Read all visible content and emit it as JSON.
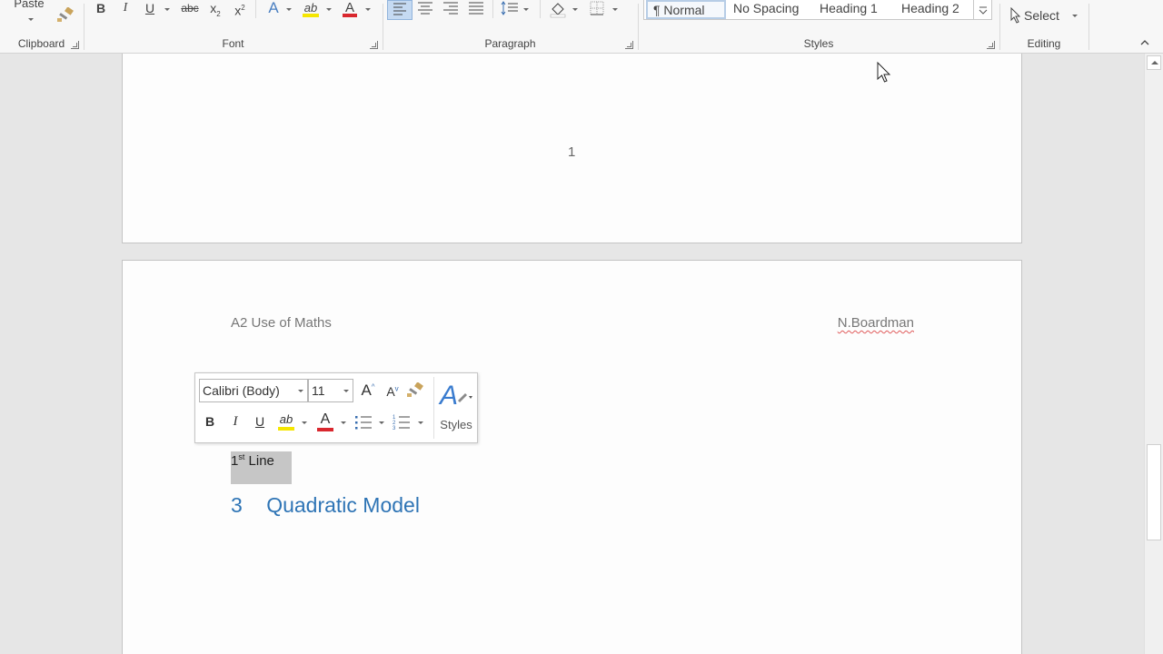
{
  "ribbon": {
    "clipboard": {
      "paste_label": "Paste",
      "group_label": "Clipboard"
    },
    "font": {
      "group_label": "Font",
      "bold": "B",
      "italic": "I",
      "underline": "U",
      "strike": "abc",
      "subscript": "x",
      "subscript_mark": "2",
      "superscript": "x",
      "superscript_mark": "2",
      "text_effects": "A",
      "highlight": "ab",
      "font_color": "A"
    },
    "paragraph": {
      "group_label": "Paragraph"
    },
    "styles": {
      "group_label": "Styles",
      "items": [
        "¶ Normal",
        "No Spacing",
        "Heading 1",
        "Heading 2"
      ]
    },
    "editing": {
      "group_label": "Editing",
      "select_label": "Select"
    }
  },
  "page1": {
    "page_number": "1"
  },
  "page2": {
    "header_left": "A2 Use of Maths",
    "header_right": "N.Boardman",
    "line_main": "1",
    "line_sup": "st",
    "line_rest": " Line",
    "heading_number": "3",
    "heading_text": "Quadratic Model"
  },
  "mini_toolbar": {
    "font_name": "Calibri (Body)",
    "font_size": "11",
    "grow": "A",
    "shrink": "A",
    "bold": "B",
    "italic": "I",
    "underline": "U",
    "highlight": "ab",
    "font_color": "A",
    "styles_label": "Styles"
  },
  "colors": {
    "highlight_yellow": "#f5e600",
    "font_red": "#d9272e",
    "heading_blue": "#2e74b5",
    "selection_gray": "#c6c6c6"
  }
}
